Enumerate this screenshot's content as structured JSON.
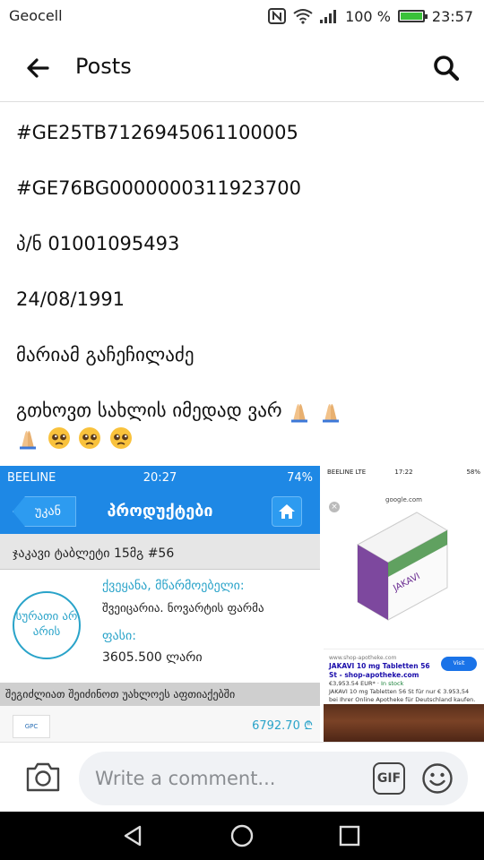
{
  "status_bar": {
    "carrier": "Geocell",
    "battery_percent": "100 %",
    "battery_level": 1.0,
    "time": "23:57",
    "icons": [
      "nfc-icon",
      "wifi-icon",
      "signal-icon",
      "battery-icon"
    ]
  },
  "app_bar": {
    "title": "Posts",
    "back_icon": "arrow-left-icon",
    "search_icon": "search-icon"
  },
  "post": {
    "lines": [
      "#GE25TB7126945061100005",
      "#GE76BG0000000311923700",
      "პ/ნ 01001095493",
      "24/08/1991",
      "მარიამ გაჩეჩილაძე",
      "გთხოვთ სახლის იმედად ვარ"
    ],
    "emoji": [
      "folded-hands-emoji",
      "folded-hands-emoji",
      "folded-hands-emoji",
      "pleading-face-emoji",
      "pleading-face-emoji",
      "pleading-face-emoji"
    ]
  },
  "image_left": {
    "status_carrier": "BEELINE",
    "status_time": "20:27",
    "status_battery": "74%",
    "back_label": "უკან",
    "title": "პროდუქტები",
    "product_row": "ჯაკავი ტაბლეტი 15მგ #56",
    "no_image_badge": "სურათი არ არის",
    "country_label": "ქვეყანა, მწარმოებელი:",
    "country_value": "შვეიცარია. ნოვარტის ფარმა",
    "price_label": "ფასი:",
    "price_value": "3605.500 ლარი",
    "nearby_row": "შეგიძლიათ შეიძინოთ უახლოეს აფთიაქებში",
    "pharmacy_logo": "GPC",
    "pharmacy_price": "6792.70 ₾"
  },
  "image_right": {
    "status_carrier": "BEELINE  LTE",
    "status_time": "17:22",
    "status_battery": "58%",
    "url": "google.com",
    "box_brand": "JAKAVI",
    "site": "www.shop-apotheke.com",
    "result_title": "JAKAVI 10 mg Tabletten 56 St - shop-apotheke.com",
    "result_price": "€3,953.54 EUR*",
    "result_stock": "In stock",
    "result_desc": "JAKAVI 10 mg Tabletten 56 St für nur € 3.953,54 bei Ihrer Online Apotheke für Deutschland kaufen.",
    "visit_label": "Visit"
  },
  "comment_bar": {
    "placeholder": "Write a comment...",
    "gif_label": "GIF",
    "camera_icon": "camera-icon",
    "emoji_icon": "smiley-icon"
  },
  "nav_bar": {
    "buttons": [
      "back-triangle-icon",
      "home-circle-icon",
      "recents-square-icon"
    ]
  },
  "colors": {
    "accent_blue": "#1e88e5",
    "teal_text": "#29a3c9",
    "battery_green": "#3ac23a"
  }
}
